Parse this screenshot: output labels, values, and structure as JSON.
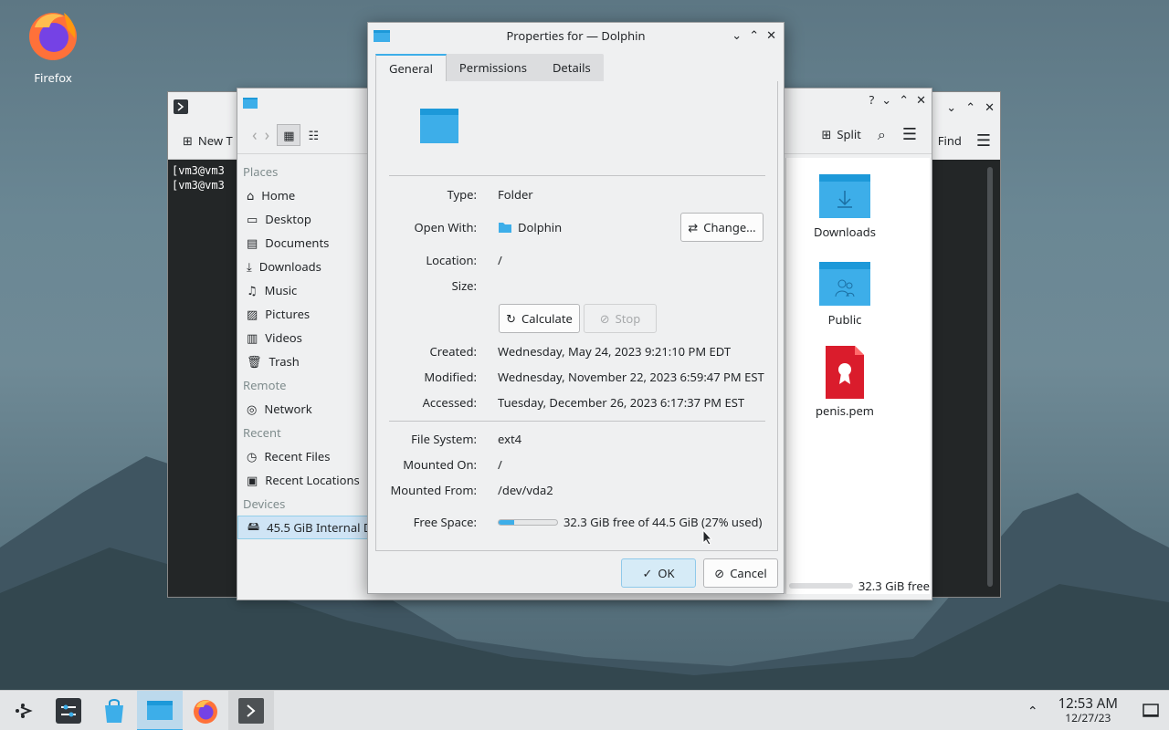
{
  "desktop": {
    "firefox_label": "Firefox"
  },
  "terminal": {
    "new_tab_label": "New T",
    "lines": [
      "[vm3@vm3",
      "[vm3@vm3"
    ]
  },
  "dolphin": {
    "places_header": "Places",
    "places": [
      "Home",
      "Desktop",
      "Documents",
      "Downloads",
      "Music",
      "Pictures",
      "Videos",
      "Trash"
    ],
    "remote_header": "Remote",
    "remote": [
      "Network"
    ],
    "recent_header": "Recent",
    "recent": [
      "Recent Files",
      "Recent Locations"
    ],
    "devices_header": "Devices",
    "devices": [
      "45.5 GiB Internal D"
    ],
    "split_label": "Split",
    "files": [
      "Downloads",
      "Public",
      "penis.pem"
    ],
    "status_free": "32.3 GiB free",
    "help_glyph": "?"
  },
  "konsole_right": {
    "find_label": "Find"
  },
  "dialog": {
    "title": "Properties for — Dolphin",
    "tabs": [
      "General",
      "Permissions",
      "Details"
    ],
    "fields": {
      "type_label": "Type:",
      "type_value": "Folder",
      "open_with_label": "Open With:",
      "open_with_value": "Dolphin",
      "change_button": "Change...",
      "location_label": "Location:",
      "location_value": "/",
      "size_label": "Size:",
      "calculate_button": "Calculate",
      "stop_button": "Stop",
      "created_label": "Created:",
      "created_value": "Wednesday, May 24, 2023 9:21:10 PM EDT",
      "modified_label": "Modified:",
      "modified_value": "Wednesday, November 22, 2023 6:59:47 PM EST",
      "accessed_label": "Accessed:",
      "accessed_value": "Tuesday, December 26, 2023 6:17:37 PM EST",
      "fs_label": "File System:",
      "fs_value": "ext4",
      "mounted_on_label": "Mounted On:",
      "mounted_on_value": "/",
      "mounted_from_label": "Mounted From:",
      "mounted_from_value": "/dev/vda2",
      "free_label": "Free Space:",
      "free_value": "32.3 GiB free of 44.5 GiB (27% used)",
      "used_fraction": 0.27
    },
    "ok_button": "OK",
    "cancel_button": "Cancel"
  },
  "taskbar": {
    "time": "12:53 AM",
    "date": "12/27/23"
  },
  "colors": {
    "accent": "#3daee9",
    "folder": "#3daee9",
    "pem_red": "#da1c2c"
  }
}
